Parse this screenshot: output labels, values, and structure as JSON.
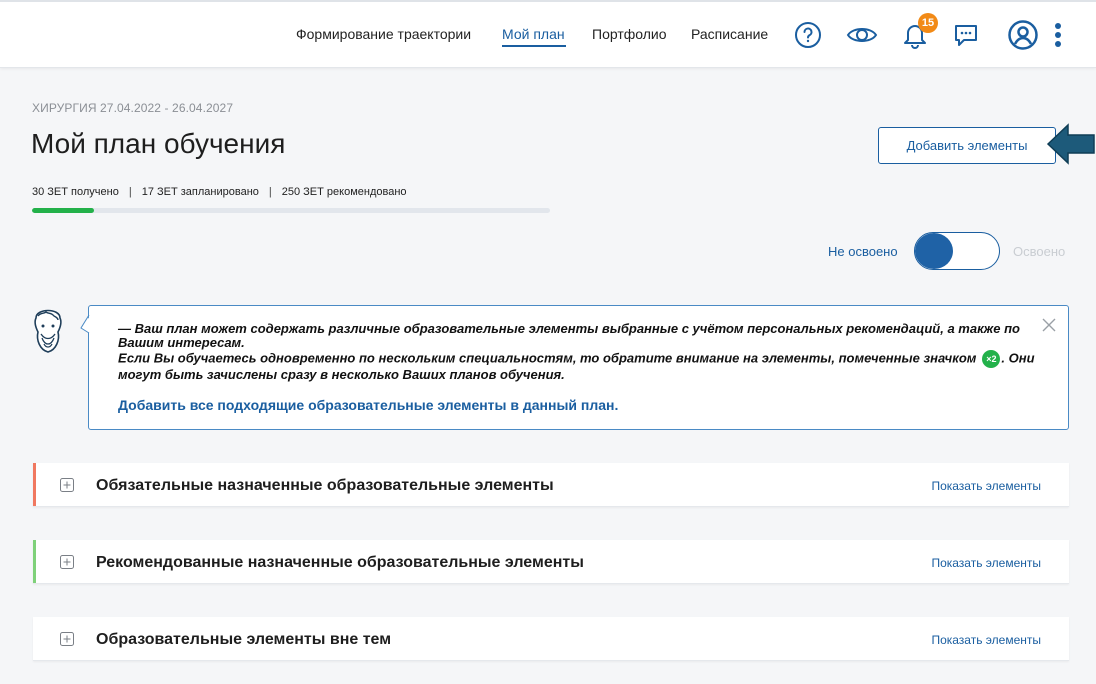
{
  "nav": {
    "items": [
      "Формирование траектории",
      "Мой план",
      "Портфолио",
      "Расписание"
    ],
    "active": "Мой план",
    "notifications_count": "15"
  },
  "header": {
    "breadcrumb": "ХИРУРГИЯ 27.04.2022 - 26.04.2027",
    "title": "Мой план обучения",
    "add_button": "Добавить элементы"
  },
  "stats": {
    "received": "30 ЗЕТ получено",
    "separator": "|",
    "planned": "17 ЗЕТ запланировано",
    "recommended": "250 ЗЕТ рекомендовано",
    "progress_fraction": 0.12
  },
  "toggle": {
    "off_label": "Не освоено",
    "on_label": "Освоено"
  },
  "info": {
    "line1": "— Ваш план может содержать различные образовательные элементы выбранные с учётом персональных рекомендаций, а также по Вашим интересам.",
    "line2_pre": "Если Вы обучаетесь одновременно по нескольким специальностям, то обратите внимание на элементы, помеченные значком",
    "badge": "×2",
    "line2_post": ". Они могут быть зачислены сразу в несколько Ваших планов обучения.",
    "link": "Добавить все подходящие образовательные элементы в данный план."
  },
  "sections": [
    {
      "title": "Обязательные назначенные образовательные элементы",
      "action": "Показать элементы",
      "accent": "#f07860"
    },
    {
      "title": "Рекомендованные назначенные образовательные элементы",
      "action": "Показать элементы",
      "accent": "#7fd17a"
    },
    {
      "title": "Образовательные элементы вне тем",
      "action": "Показать элементы",
      "accent": ""
    }
  ],
  "colors": {
    "primary": "#1a5ea0",
    "progress": "#23b14a",
    "badge": "#f28a16",
    "arrow": "#1d5a7a"
  },
  "icons": [
    "help-icon",
    "eye-icon",
    "bell-icon",
    "chat-icon",
    "user-icon",
    "more-vertical-icon",
    "plus-square-icon",
    "close-icon",
    "avatar-sage-icon"
  ]
}
